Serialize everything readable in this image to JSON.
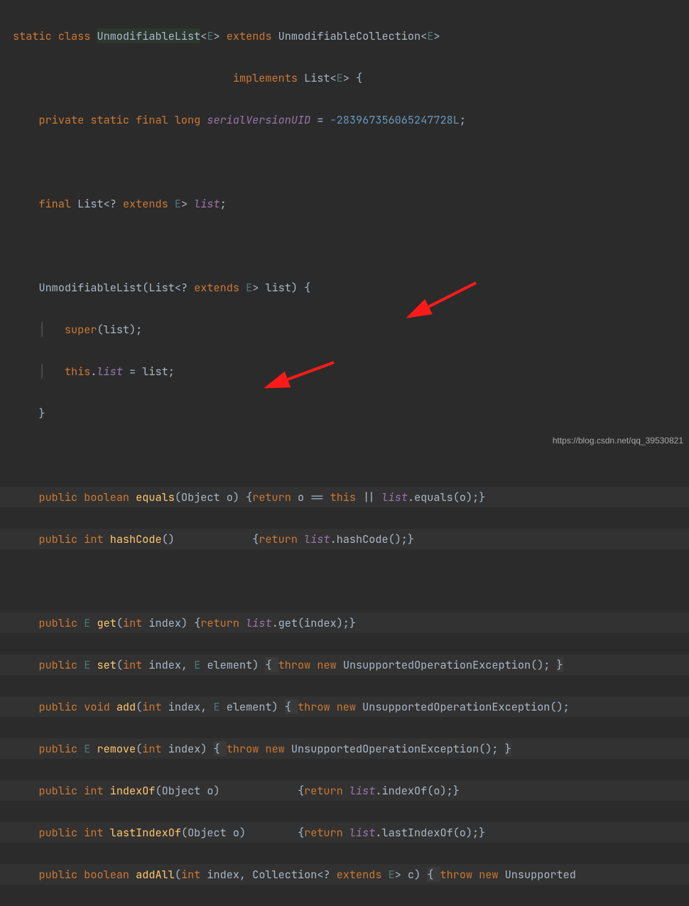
{
  "code": {
    "l1": {
      "k1": "static class ",
      "name": "UnmodifiableList",
      "g1": "<",
      "gE": "E",
      "g2": "> ",
      "k2": "extends ",
      "sup": "UnmodifiableCollection",
      "g3": "<",
      "gE2": "E",
      "g4": ">"
    },
    "l2": {
      "k1": "implements ",
      "intf": "List",
      "g1": "<",
      "gE": "E",
      "g2": "> {"
    },
    "l3": {
      "k1": "private static final long ",
      "f": "serialVersionUID",
      "eq": " = ",
      "n": "-283967356065247728L",
      "s": ";"
    },
    "l4": {
      "k1": "final ",
      "t": "List",
      "g1": "<? ",
      "k2": "extends ",
      "gE": "E",
      "g2": "> ",
      "f": "list",
      "s": ";"
    },
    "l5": {
      "ctor": "UnmodifiableList",
      "p": "(List",
      "g1": "<? ",
      "k1": "extends ",
      "gE": "E",
      "g2": "> ",
      "arg": "list) {"
    },
    "l6": {
      "k1": "super",
      "r": "(list);"
    },
    "l7": {
      "k1": "this",
      "dot": ".",
      "f": "list",
      "r": " = list;"
    },
    "l8": {
      "b": "}"
    },
    "l9": {
      "k1": "public boolean ",
      "m": "equals",
      "p": "(Object o) {",
      "k2": "return ",
      "r": "o == ",
      "k3": "this ",
      "op": "|| ",
      "f": "list",
      "r2": ".equals(o);}"
    },
    "l10": {
      "k1": "public int ",
      "m": "hashCode",
      "p": "()            {",
      "k2": "return ",
      "f": "list",
      "r": ".hashCode();}"
    },
    "l11": {
      "k1": "public ",
      "gE": "E ",
      "m": "get",
      "p": "(",
      "k2": "int ",
      "arg": "index) {",
      "k3": "return ",
      "f": "list",
      "r": ".get(index);}"
    },
    "l12": {
      "k1": "public ",
      "gE": "E ",
      "m": "set",
      "p": "(",
      "k2": "int ",
      "arg": "index, ",
      "gE2": "E ",
      "arg2": "element) ",
      "db1": "{ ",
      "k3": "throw new ",
      "ex": "UnsupportedOperationException(); ",
      "db2": "}"
    },
    "l13": {
      "k1": "public void ",
      "m": "add",
      "p": "(",
      "k2": "int ",
      "arg": "index, ",
      "gE": "E ",
      "arg2": "element) ",
      "db1": "{ ",
      "k3": "throw new ",
      "ex": "UnsupportedOperationException();"
    },
    "l14": {
      "k1": "public ",
      "gE": "E ",
      "m": "remove",
      "p": "(",
      "k2": "int ",
      "arg": "index) ",
      "db1": "{ ",
      "k3": "throw new ",
      "ex": "UnsupportedOperationException(); ",
      "db2": "}"
    },
    "l15": {
      "k1": "public int ",
      "m": "indexOf",
      "p": "(Object o)            {",
      "k2": "return ",
      "f": "list",
      "r": ".indexOf(o);}"
    },
    "l16": {
      "k1": "public int ",
      "m": "lastIndexOf",
      "p": "(Object o)        {",
      "k2": "return ",
      "f": "list",
      "r": ".lastIndexOf(o);}"
    },
    "l17": {
      "k1": "public boolean ",
      "m": "addAll",
      "p": "(",
      "k2": "int ",
      "arg": "index, Collection",
      "g1": "<? ",
      "k3": "extends ",
      "gE": "E",
      "g2": "> ",
      "arg2": "c) ",
      "db1": "{ ",
      "k4": "throw new ",
      "ex": "Unsupported"
    }
  },
  "watermark": "https://blog.csdn.net/qq_39530821"
}
